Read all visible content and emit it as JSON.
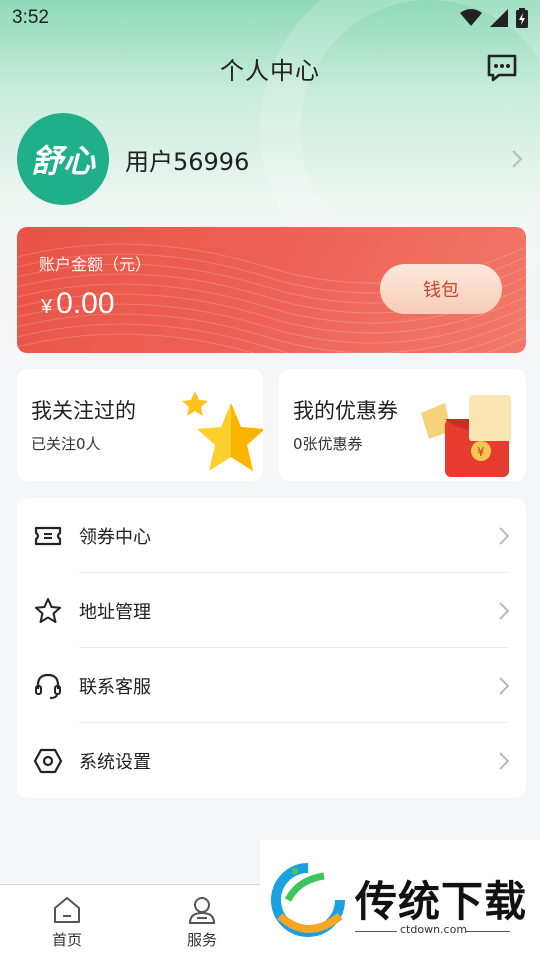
{
  "status_bar": {
    "time": "3:52"
  },
  "header": {
    "title": "个人中心",
    "message_icon": "chat-message-icon"
  },
  "profile": {
    "avatar_text": "舒心",
    "username": "用户56996"
  },
  "balance": {
    "label": "账户金额（元）",
    "currency": "¥",
    "amount": "0.00",
    "wallet_button": "钱包"
  },
  "stats": [
    {
      "title": "我关注过的",
      "sub": "已关注0人",
      "art": "star-icon"
    },
    {
      "title": "我的优惠券",
      "sub": "0张优惠券",
      "art": "red-packet-icon"
    }
  ],
  "menu": [
    {
      "label": "领券中心",
      "icon": "ticket-icon"
    },
    {
      "label": "地址管理",
      "icon": "star-outline-icon"
    },
    {
      "label": "联系客服",
      "icon": "headset-icon"
    },
    {
      "label": "系统设置",
      "icon": "settings-hexagon-icon"
    }
  ],
  "tabs": [
    {
      "label": "首页",
      "icon": "home-icon"
    },
    {
      "label": "服务",
      "icon": "service-user-icon"
    }
  ],
  "watermark": {
    "text": "传统下载",
    "url": "ctdown.com"
  },
  "colors": {
    "accent_green": "#1fb089",
    "balance_red": "#e85345",
    "wallet_text": "#c4462a"
  }
}
